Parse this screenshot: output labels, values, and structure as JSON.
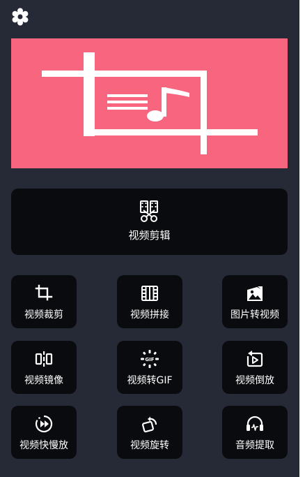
{
  "header": {
    "settings_icon": "gear-icon"
  },
  "banner": {
    "icon": "crop-music-icon",
    "accent_color": "#f7657f"
  },
  "main_feature": {
    "label": "视频剪辑",
    "icon": "film-scissors-icon"
  },
  "tools": [
    {
      "label": "视频裁剪",
      "icon": "crop-icon"
    },
    {
      "label": "视频拼接",
      "icon": "film-strip-icon"
    },
    {
      "label": "图片转视频",
      "icon": "image-to-video-icon"
    },
    {
      "label": "视频镜像",
      "icon": "mirror-icon"
    },
    {
      "label": "视频转GIF",
      "icon": "gif-icon"
    },
    {
      "label": "视频倒放",
      "icon": "reverse-play-icon"
    },
    {
      "label": "视频快慢放",
      "icon": "speed-icon"
    },
    {
      "label": "视频旋转",
      "icon": "rotate-icon"
    },
    {
      "label": "音频提取",
      "icon": "headphones-icon"
    }
  ],
  "colors": {
    "background": "#262a36",
    "card": "#0a0b0e",
    "text": "#ffffff"
  }
}
